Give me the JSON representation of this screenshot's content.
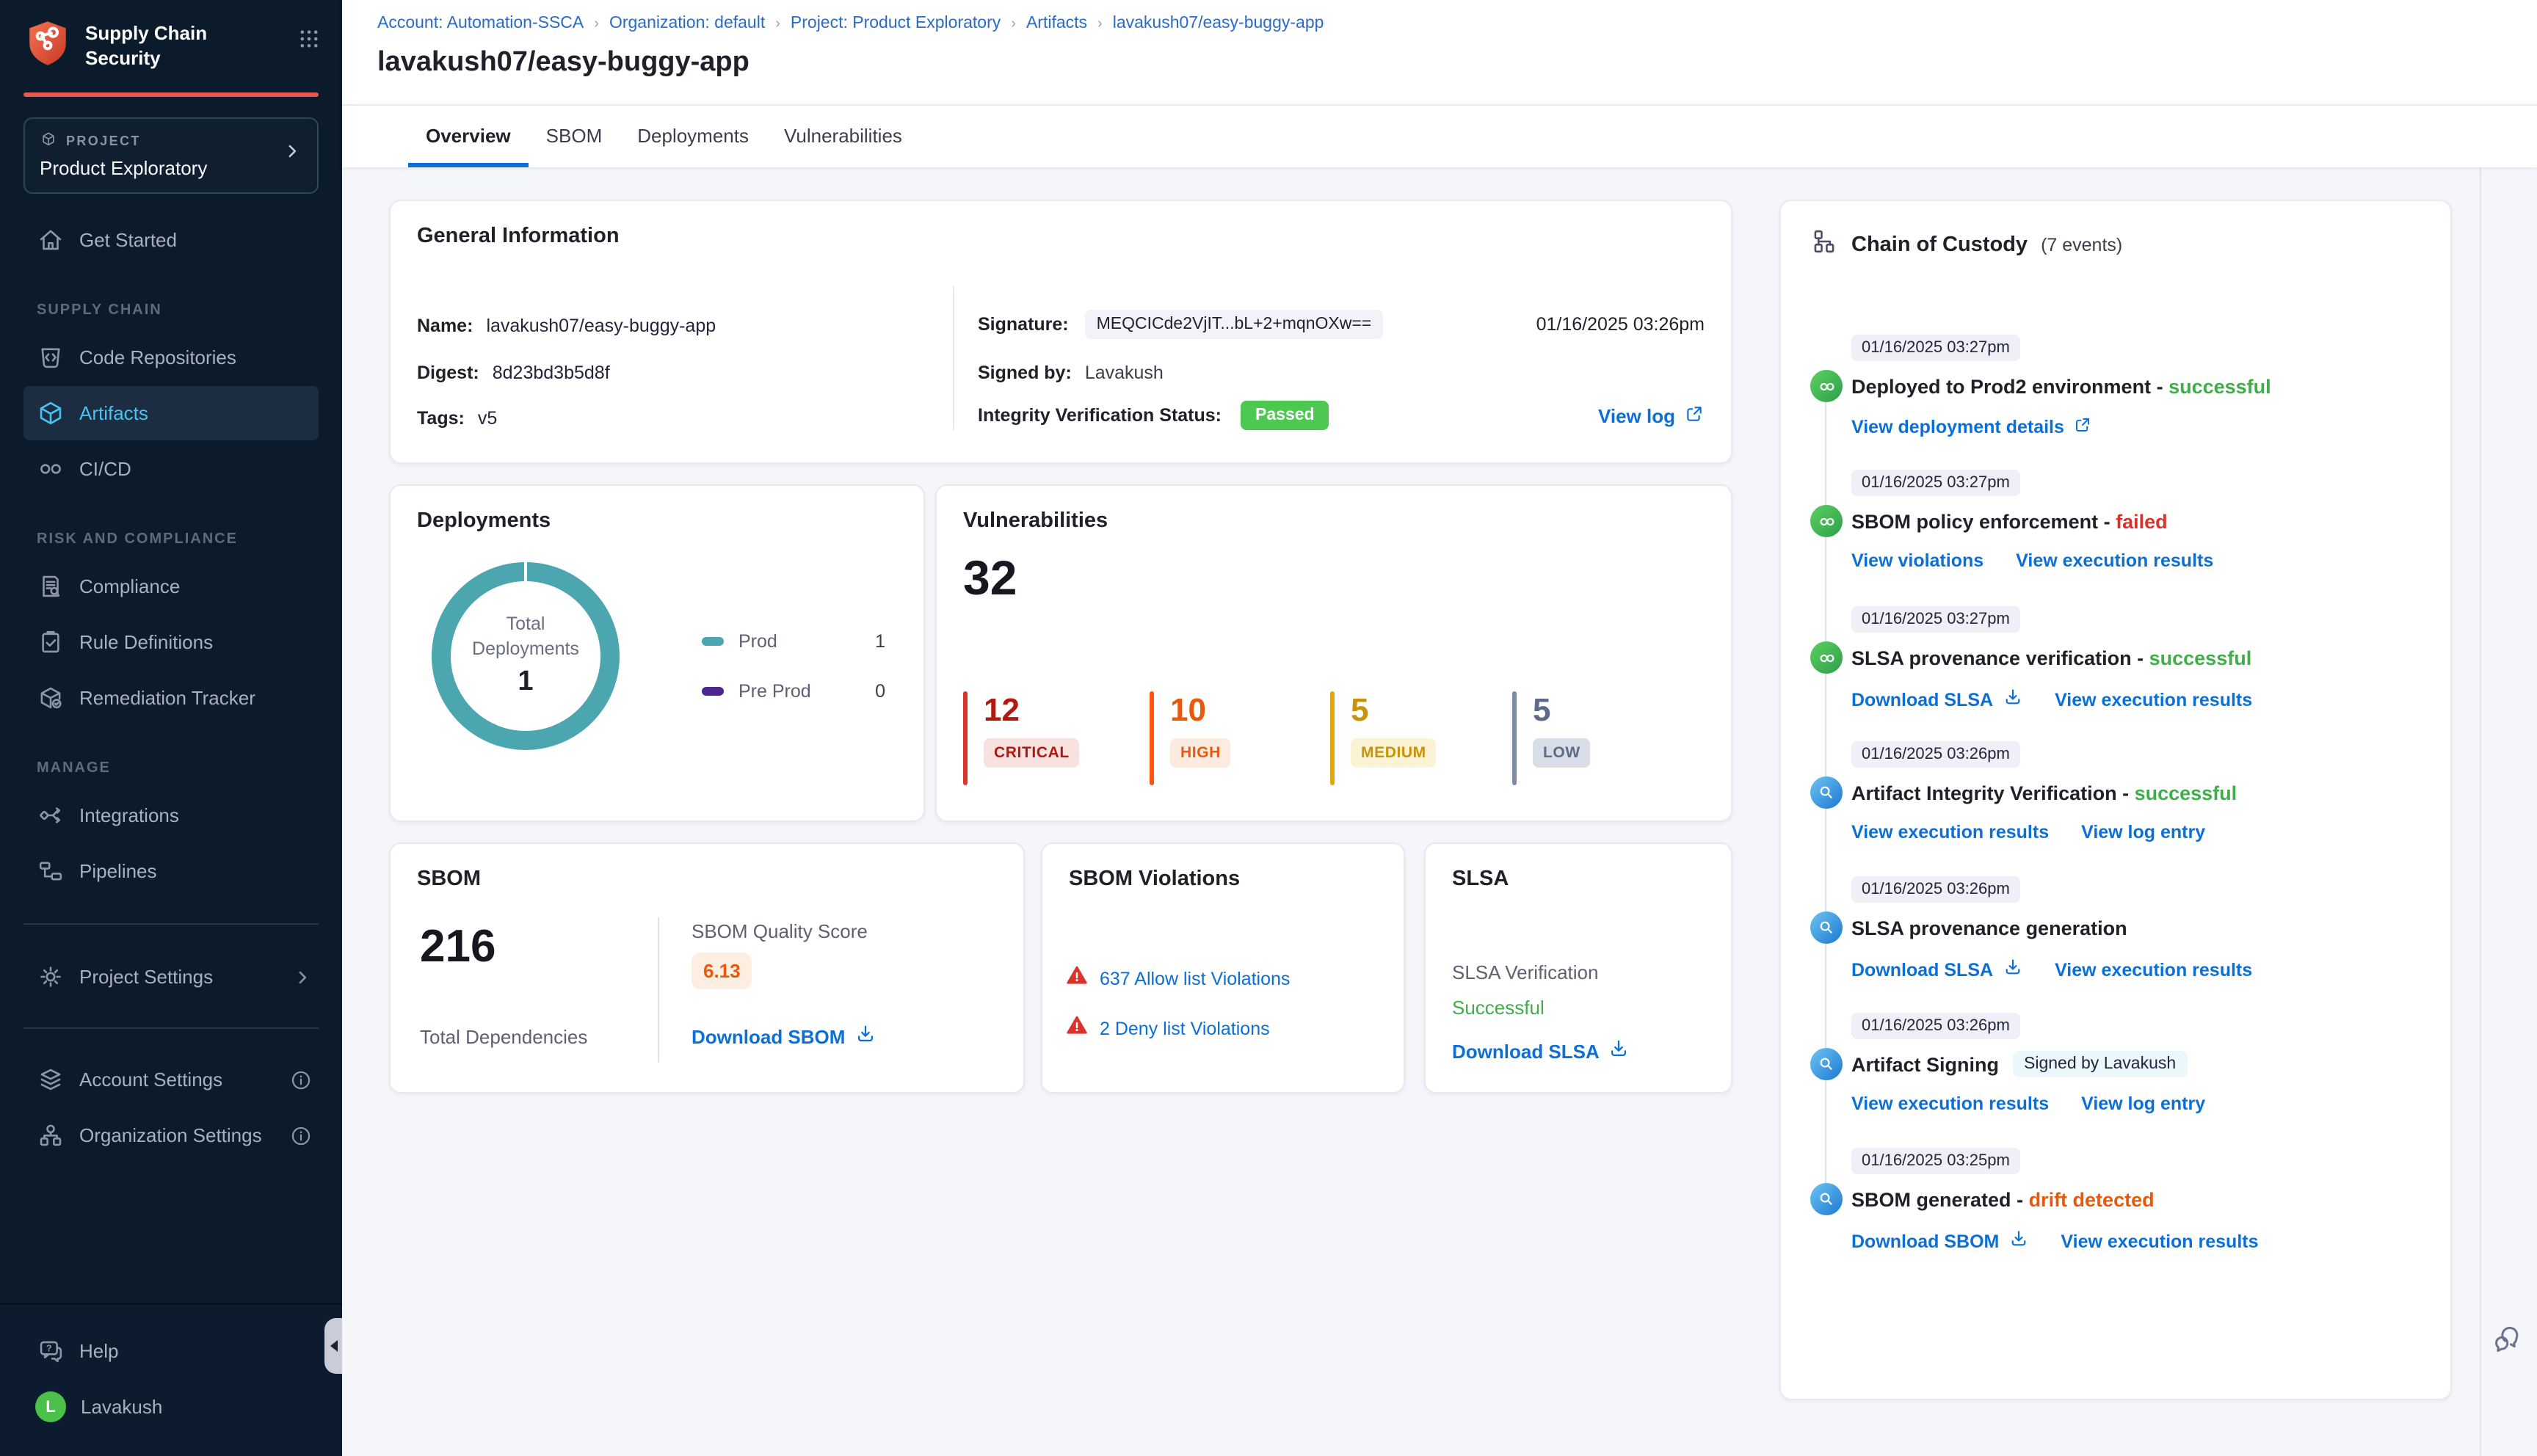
{
  "sidebar": {
    "logo_title_line1": "Supply Chain",
    "logo_title_line2": "Security",
    "project_label": "PROJECT",
    "project_name": "Product Exploratory",
    "nav_sections": [
      {
        "label": "",
        "items": [
          {
            "icon": "home",
            "label": "Get Started",
            "active": false
          }
        ]
      },
      {
        "label": "SUPPLY CHAIN",
        "items": [
          {
            "icon": "code-repo",
            "label": "Code Repositories",
            "active": false
          },
          {
            "icon": "cube",
            "label": "Artifacts",
            "active": true
          },
          {
            "icon": "infinity",
            "label": "CI/CD",
            "active": false
          }
        ]
      },
      {
        "label": "RISK AND COMPLIANCE",
        "items": [
          {
            "icon": "doc-search",
            "label": "Compliance",
            "active": false
          },
          {
            "icon": "clipboard-check",
            "label": "Rule Definitions",
            "active": false
          },
          {
            "icon": "box-check",
            "label": "Remediation Tracker",
            "active": false
          }
        ]
      },
      {
        "label": "MANAGE",
        "items": [
          {
            "icon": "integrations",
            "label": "Integrations",
            "active": false
          },
          {
            "icon": "pipelines",
            "label": "Pipelines",
            "active": false
          }
        ]
      }
    ],
    "settings_items": [
      {
        "icon": "gear",
        "label": "Project Settings",
        "trailing": "chevron"
      },
      {
        "icon": "layers",
        "label": "Account Settings",
        "trailing": "info"
      },
      {
        "icon": "org",
        "label": "Organization Settings",
        "trailing": "info"
      }
    ],
    "help_label": "Help",
    "user_name": "Lavakush",
    "user_initial": "L"
  },
  "header": {
    "breadcrumb": [
      "Account: Automation-SSCA",
      "Organization: default",
      "Project: Product Exploratory",
      "Artifacts",
      "lavakush07/easy-buggy-app"
    ],
    "title": "lavakush07/easy-buggy-app",
    "tabs": [
      {
        "label": "Overview",
        "active": true
      },
      {
        "label": "SBOM",
        "active": false
      },
      {
        "label": "Deployments",
        "active": false
      },
      {
        "label": "Vulnerabilities",
        "active": false
      }
    ]
  },
  "general_info": {
    "title": "General Information",
    "name_label": "Name:",
    "name": "lavakush07/easy-buggy-app",
    "digest_label": "Digest:",
    "digest": "8d23bd3b5d8f",
    "tags_label": "Tags:",
    "tags": "v5",
    "signature_label": "Signature:",
    "signature": "MEQCICde2VjIT...bL+2+mqnOXw==",
    "signature_date": "01/16/2025 03:26pm",
    "signed_by_label": "Signed by:",
    "signed_by": "Lavakush",
    "integrity_label": "Integrity Verification Status:",
    "integrity_status": "Passed",
    "view_log_label": "View log"
  },
  "deployments_card": {
    "title": "Deployments",
    "center_line1": "Total",
    "center_line2": "Deployments",
    "total": "1",
    "donut_color": "#4BA6B0",
    "legend": [
      {
        "label": "Prod",
        "value": "1",
        "color": "#4BA6B0"
      },
      {
        "label": "Pre Prod",
        "value": "0",
        "color": "#4D278F"
      }
    ]
  },
  "vulnerabilities_card": {
    "title": "Vulnerabilities",
    "total": "32",
    "severities": [
      {
        "count": "12",
        "label": "CRITICAL",
        "color": "#B41710",
        "bar": "#DA352C",
        "bg": "#F9E1DF"
      },
      {
        "count": "10",
        "label": "HIGH",
        "color": "#E8590C",
        "bar": "#FF5310",
        "bg": "#FDEBE0"
      },
      {
        "count": "5",
        "label": "MEDIUM",
        "color": "#C99207",
        "bar": "#E2A614",
        "bg": "#FBF3D3"
      },
      {
        "count": "5",
        "label": "LOW",
        "color": "#5C6B87",
        "bar": "#7D8BA6",
        "bg": "#D9DDE7"
      }
    ]
  },
  "sbom_card": {
    "title": "SBOM",
    "total": "216",
    "total_label": "Total Dependencies",
    "quality_label": "SBOM Quality Score",
    "quality_score": "6.13",
    "download_label": "Download SBOM"
  },
  "sbom_violations_card": {
    "title": "SBOM Violations",
    "items": [
      {
        "label": "637 Allow list Violations"
      },
      {
        "label": "2 Deny list Violations"
      }
    ]
  },
  "slsa_card": {
    "title": "SLSA",
    "verification_label": "SLSA Verification",
    "status": "Successful",
    "download_label": "Download SLSA"
  },
  "chain_of_custody": {
    "title": "Chain of Custody",
    "count": "(7 events)",
    "events": [
      {
        "time": "01/16/2025 03:27pm",
        "icon": "green",
        "title": "Deployed to Prod2 environment",
        "status": "successful",
        "status_color": "green",
        "links": [
          {
            "label": "View deployment details",
            "icon": "external"
          }
        ]
      },
      {
        "time": "01/16/2025 03:27pm",
        "icon": "green",
        "title": "SBOM policy enforcement",
        "status": "failed",
        "status_color": "red",
        "links": [
          {
            "label": "View violations"
          },
          {
            "label": "View execution results"
          }
        ]
      },
      {
        "time": "01/16/2025 03:27pm",
        "icon": "green",
        "title": "SLSA provenance verification",
        "status": "successful",
        "status_color": "green",
        "links": [
          {
            "label": "Download SLSA",
            "icon": "download"
          },
          {
            "label": "View execution results"
          }
        ]
      },
      {
        "time": "01/16/2025 03:26pm",
        "icon": "blue",
        "title": "Artifact Integrity Verification",
        "status": "successful",
        "status_color": "green",
        "links": [
          {
            "label": "View execution results"
          },
          {
            "label": "View log entry"
          }
        ]
      },
      {
        "time": "01/16/2025 03:26pm",
        "icon": "blue",
        "title": "SLSA provenance generation",
        "links": [
          {
            "label": "Download SLSA",
            "icon": "download"
          },
          {
            "label": "View execution results"
          }
        ]
      },
      {
        "time": "01/16/2025 03:26pm",
        "icon": "blue",
        "title": "Artifact Signing",
        "badge": "Signed by Lavakush",
        "links": [
          {
            "label": "View execution results"
          },
          {
            "label": "View log entry"
          }
        ]
      },
      {
        "time": "01/16/2025 03:25pm",
        "icon": "blue",
        "title": "SBOM generated",
        "status": "drift detected",
        "status_color": "orange",
        "links": [
          {
            "label": "Download SBOM",
            "icon": "download"
          },
          {
            "label": "View execution results"
          }
        ]
      }
    ]
  }
}
